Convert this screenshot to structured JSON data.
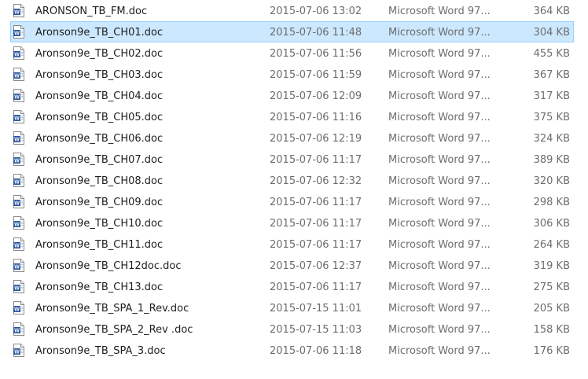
{
  "files": [
    {
      "name": "ARONSON_TB_FM.doc",
      "date": "2015-07-06 13:02",
      "type": "Microsoft Word 97...",
      "size": "364 KB",
      "selected": false
    },
    {
      "name": "Aronson9e_TB_CH01.doc",
      "date": "2015-07-06 11:48",
      "type": "Microsoft Word 97...",
      "size": "304 KB",
      "selected": true
    },
    {
      "name": "Aronson9e_TB_CH02.doc",
      "date": "2015-07-06 11:56",
      "type": "Microsoft Word 97...",
      "size": "455 KB",
      "selected": false
    },
    {
      "name": "Aronson9e_TB_CH03.doc",
      "date": "2015-07-06 11:59",
      "type": "Microsoft Word 97...",
      "size": "367 KB",
      "selected": false
    },
    {
      "name": "Aronson9e_TB_CH04.doc",
      "date": "2015-07-06 12:09",
      "type": "Microsoft Word 97...",
      "size": "317 KB",
      "selected": false
    },
    {
      "name": "Aronson9e_TB_CH05.doc",
      "date": "2015-07-06 11:16",
      "type": "Microsoft Word 97...",
      "size": "375 KB",
      "selected": false
    },
    {
      "name": "Aronson9e_TB_CH06.doc",
      "date": "2015-07-06 12:19",
      "type": "Microsoft Word 97...",
      "size": "324 KB",
      "selected": false
    },
    {
      "name": "Aronson9e_TB_CH07.doc",
      "date": "2015-07-06 11:17",
      "type": "Microsoft Word 97...",
      "size": "389 KB",
      "selected": false
    },
    {
      "name": "Aronson9e_TB_CH08.doc",
      "date": "2015-07-06 12:32",
      "type": "Microsoft Word 97...",
      "size": "320 KB",
      "selected": false
    },
    {
      "name": "Aronson9e_TB_CH09.doc",
      "date": "2015-07-06 11:17",
      "type": "Microsoft Word 97...",
      "size": "298 KB",
      "selected": false
    },
    {
      "name": "Aronson9e_TB_CH10.doc",
      "date": "2015-07-06 11:17",
      "type": "Microsoft Word 97...",
      "size": "306 KB",
      "selected": false
    },
    {
      "name": "Aronson9e_TB_CH11.doc",
      "date": "2015-07-06 11:17",
      "type": "Microsoft Word 97...",
      "size": "264 KB",
      "selected": false
    },
    {
      "name": "Aronson9e_TB_CH12doc.doc",
      "date": "2015-07-06 12:37",
      "type": "Microsoft Word 97...",
      "size": "319 KB",
      "selected": false
    },
    {
      "name": "Aronson9e_TB_CH13.doc",
      "date": "2015-07-06 11:17",
      "type": "Microsoft Word 97...",
      "size": "275 KB",
      "selected": false
    },
    {
      "name": "Aronson9e_TB_SPA_1_Rev.doc",
      "date": "2015-07-15 11:01",
      "type": "Microsoft Word 97...",
      "size": "205 KB",
      "selected": false
    },
    {
      "name": "Aronson9e_TB_SPA_2_Rev .doc",
      "date": "2015-07-15 11:03",
      "type": "Microsoft Word 97...",
      "size": "158 KB",
      "selected": false
    },
    {
      "name": "Aronson9e_TB_SPA_3.doc",
      "date": "2015-07-06 11:18",
      "type": "Microsoft Word 97...",
      "size": "176 KB",
      "selected": false
    }
  ],
  "icon": "word-document-icon",
  "colors": {
    "selection_bg": "#cce8ff",
    "selection_border": "#99d1ff",
    "word_blue": "#2b579a",
    "secondary_text": "#6d6d6d"
  }
}
